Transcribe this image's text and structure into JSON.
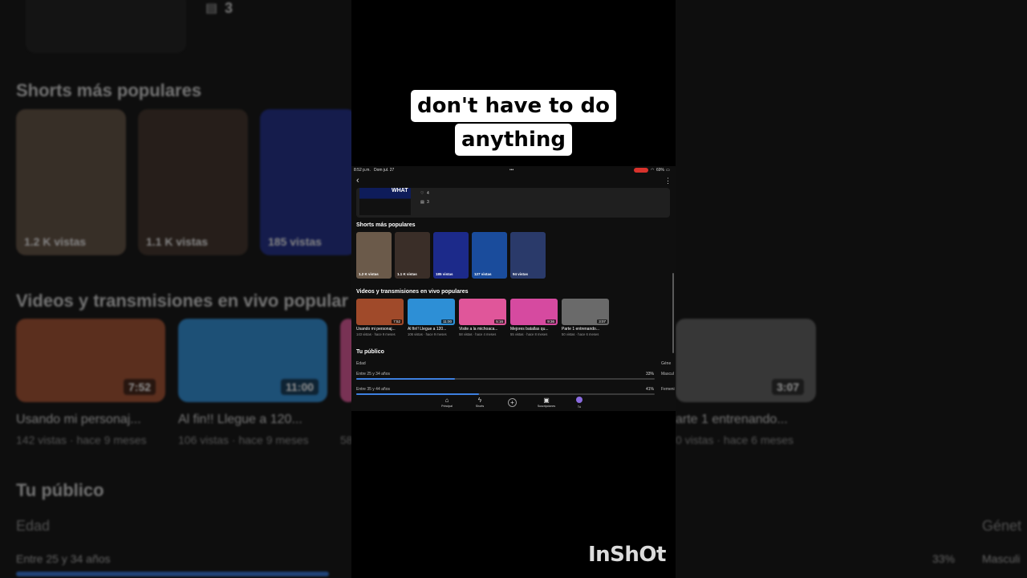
{
  "caption": {
    "line1": "don't have to do",
    "line2": "anything"
  },
  "watermark": "InShOt",
  "status_bar": {
    "time": "8:52 p.m.",
    "date": "Dom jul. 27",
    "dots": "•••",
    "battery": "69%"
  },
  "top_card": {
    "thumb_text": "WHAT",
    "likes": "4",
    "comments": "3"
  },
  "shorts": {
    "title": "Shorts más populares",
    "items": [
      {
        "views": "1.2 K vistas",
        "color": "#6b5a4a"
      },
      {
        "views": "1.1 K vistas",
        "color": "#3a2e28"
      },
      {
        "views": "185 vistas",
        "color": "#1c2a8a"
      },
      {
        "views": "127 vistas",
        "color": "#1a4c9c"
      },
      {
        "views": "94 vistas",
        "color": "#2a3a6a"
      }
    ]
  },
  "videos": {
    "title": "Videos y transmisiones en vivo populares",
    "items": [
      {
        "title": "Usando mi personaj...",
        "meta": "143 vistas · hace 9 meses",
        "duration": "7:52",
        "color": "#a04a2a"
      },
      {
        "title": "Al fin!! Llegue a 120...",
        "meta": "106 vistas · hace 9 meses",
        "duration": "11:00",
        "color": "#2d8fd6"
      },
      {
        "title": "Visite a la michoaca...",
        "meta": "58 vistas · hace 4 meses",
        "duration": "5:16",
        "color": "#e0569a"
      },
      {
        "title": "Mejores batallas qu...",
        "meta": "55 vistas · hace 8 meses",
        "duration": "9:36",
        "color": "#d64aa0"
      },
      {
        "title": "Parte 1 entrenando...",
        "meta": "50 vistas · hace 6 meses",
        "duration": "3:07",
        "color": "#6a6a6a"
      }
    ]
  },
  "audience": {
    "title": "Tu público",
    "age_label": "Edad",
    "gender_label": "Géne",
    "rows": [
      {
        "label": "Entre 25 y 34 años",
        "pct": "33%",
        "value": 0.33,
        "gender": "Mascul"
      },
      {
        "label": "Entre 35 y 44 años",
        "pct": "41%",
        "value": 0.41,
        "gender": "Femeni"
      }
    ]
  },
  "nav": {
    "home": "Principal",
    "shorts": "Shorts",
    "plus": "+",
    "subs": "Suscripciones",
    "you": "Tú"
  },
  "background": {
    "counter": "3",
    "shorts_title": "Shorts más populares",
    "shorts": [
      "1.2 K vistas",
      "1.1 K vistas",
      "185 vistas"
    ],
    "videos_title": "Videos y transmisiones en vivo popular",
    "video_durations": [
      "7:52",
      "11:00",
      "3:07"
    ],
    "video_titles": [
      "Usando mi personaj...",
      "Al fin!! Llegue a 120...",
      "arte 1 entrenando..."
    ],
    "video_meta": [
      "142 vistas · hace 9 meses",
      "106 vistas · hace 9 meses",
      "58",
      "0 vistas · hace 6 meses"
    ],
    "audience_title": "Tu público",
    "age_label": "Edad",
    "gender_label": "Génet",
    "row_label": "Entre 25 y 34 años",
    "row_pct": "33%",
    "row_gender": "Masculi"
  }
}
